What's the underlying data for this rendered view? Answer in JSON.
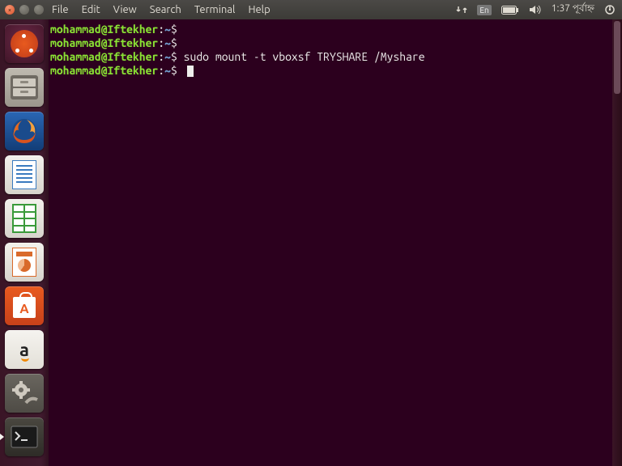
{
  "menubar": {
    "items": [
      "File",
      "Edit",
      "View",
      "Search",
      "Terminal",
      "Help"
    ]
  },
  "indicators": {
    "language": "En",
    "clock": "1:37 পূর্বাহ্ন"
  },
  "launcher": {
    "tiles": [
      {
        "name": "dash",
        "label": "Dash"
      },
      {
        "name": "files",
        "label": "Files"
      },
      {
        "name": "firefox",
        "label": "Firefox"
      },
      {
        "name": "writer",
        "label": "LibreOffice Writer"
      },
      {
        "name": "calc",
        "label": "LibreOffice Calc"
      },
      {
        "name": "impress",
        "label": "LibreOffice Impress"
      },
      {
        "name": "software",
        "label": "Ubuntu Software"
      },
      {
        "name": "amazon",
        "label": "Amazon"
      },
      {
        "name": "settings",
        "label": "System Settings"
      }
    ]
  },
  "terminal": {
    "prompt": {
      "userhost": "mohammad@Iftekher",
      "sep": ":",
      "path": "~",
      "symbol": "$"
    },
    "lines": [
      {
        "cmd": ""
      },
      {
        "cmd": ""
      },
      {
        "cmd": "sudo mount -t vboxsf TRYSHARE /Myshare"
      },
      {
        "cmd": "",
        "cursor": true
      }
    ]
  }
}
